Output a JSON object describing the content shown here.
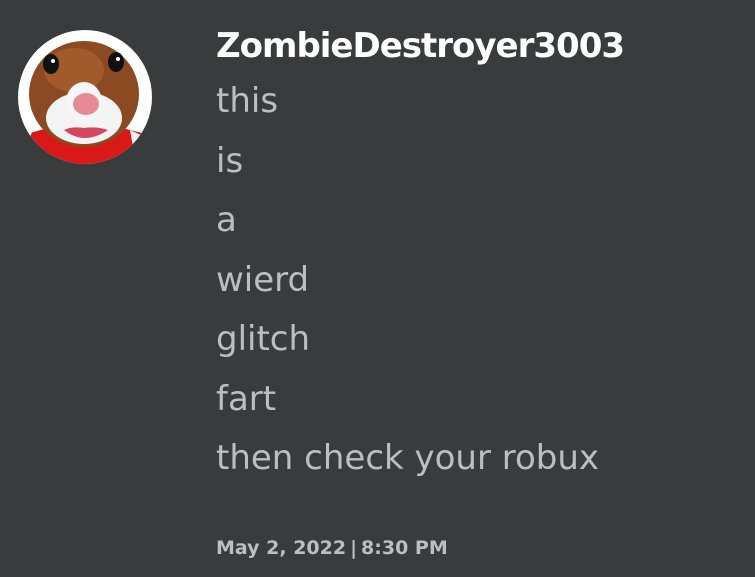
{
  "comment": {
    "username": "ZombieDestroyer3003",
    "avatar": "hamster-avatar",
    "lines": [
      "this",
      "is",
      "a",
      "wierd",
      "glitch",
      "fart",
      "then check your robux"
    ],
    "date": "May 2, 2022",
    "separator": "|",
    "time": "8:30 PM"
  },
  "colors": {
    "background": "#393b3d",
    "username": "#ffffff",
    "text": "#bdbebe"
  }
}
